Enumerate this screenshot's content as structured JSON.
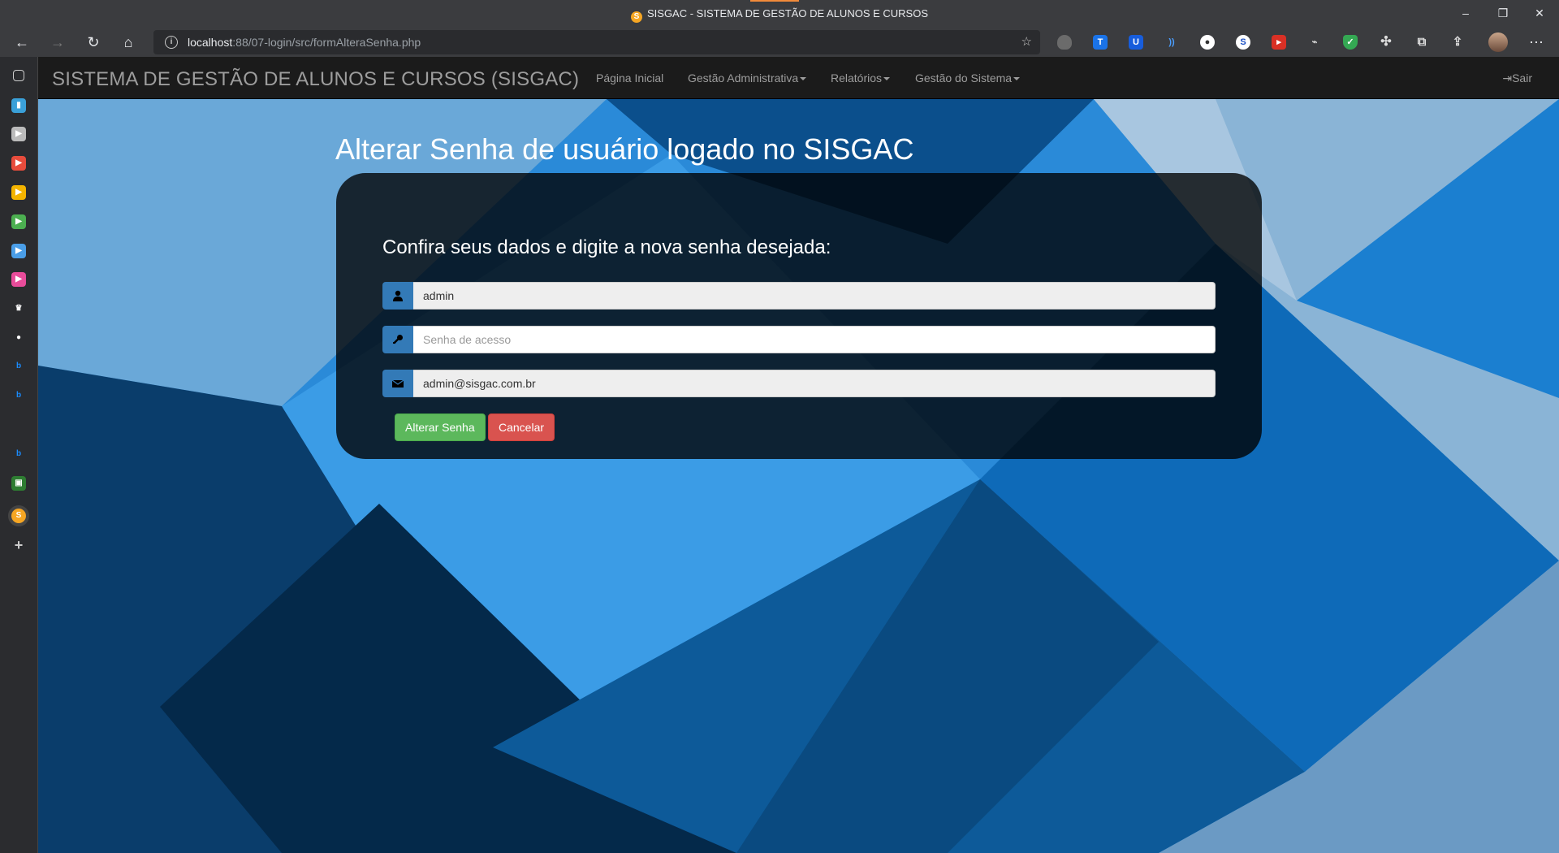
{
  "browser": {
    "tab_title": "SISGAC - SISTEMA DE GESTÃO DE ALUNOS E CURSOS",
    "url_host": "localhost",
    "url_rest": ":88/07-login/src/formAlteraSenha.php"
  },
  "navbar": {
    "brand": "SISTEMA DE GESTÃO DE ALUNOS E CURSOS (SISGAC)",
    "links": [
      "Página Inicial",
      "Gestão Administrativa",
      "Relatórios",
      "Gestão do Sistema"
    ],
    "logout": "Sair"
  },
  "form": {
    "heading": "Alterar Senha de usuário logado no SISGAC",
    "subtitle": "Confira seus dados e digite a nova senha desejada:",
    "username_value": "admin",
    "password_placeholder": "Senha de acesso",
    "email_value": "admin@sisgac.com.br",
    "submit_label": "Alterar Senha",
    "cancel_label": "Cancelar"
  },
  "colors": {
    "primary": "#337ab7",
    "success": "#5cb85c",
    "danger": "#d9534f"
  }
}
